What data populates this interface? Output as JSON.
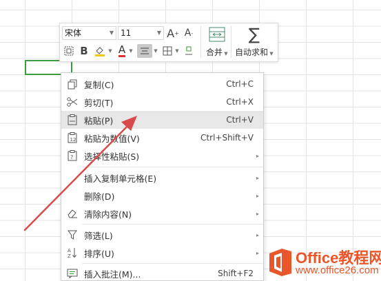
{
  "toolbar": {
    "font_name": "宋体",
    "font_size": "11",
    "merge_label": "合并",
    "autosum_label": "自动求和",
    "increase_font_glyph": "A",
    "decrease_font_glyph": "A",
    "bold_glyph": "B",
    "font_color_glyph": "A"
  },
  "context_menu": {
    "items": [
      {
        "label": "复制(C)",
        "shortcut": "Ctrl+C",
        "icon": "copy-icon"
      },
      {
        "label": "剪切(T)",
        "shortcut": "Ctrl+X",
        "icon": "cut-icon"
      },
      {
        "label": "粘贴(P)",
        "shortcut": "Ctrl+V",
        "icon": "paste-icon"
      },
      {
        "label": "粘贴为数值(V)",
        "shortcut": "Ctrl+Shift+V",
        "icon": "paste-values-icon"
      },
      {
        "label": "选择性粘贴(S)",
        "shortcut": "",
        "icon": "paste-special-icon"
      },
      {
        "label": "插入复制单元格(E)",
        "shortcut": "",
        "icon": ""
      },
      {
        "label": "删除(D)",
        "shortcut": "",
        "icon": ""
      },
      {
        "label": "清除内容(N)",
        "shortcut": "",
        "icon": "eraser-icon"
      },
      {
        "label": "筛选(L)",
        "shortcut": "",
        "icon": "filter-icon"
      },
      {
        "label": "排序(U)",
        "shortcut": "",
        "icon": "sort-icon"
      },
      {
        "label": "插入批注(M)...",
        "shortcut": "Shift+F2",
        "icon": "comment-icon"
      }
    ]
  },
  "watermark": {
    "line1": "Office教程网",
    "line2": "www.office26.com"
  },
  "colors": {
    "active_cell_border": "#3b9d3b",
    "arrow": "#d94a4a",
    "watermark": "#e8562a"
  }
}
